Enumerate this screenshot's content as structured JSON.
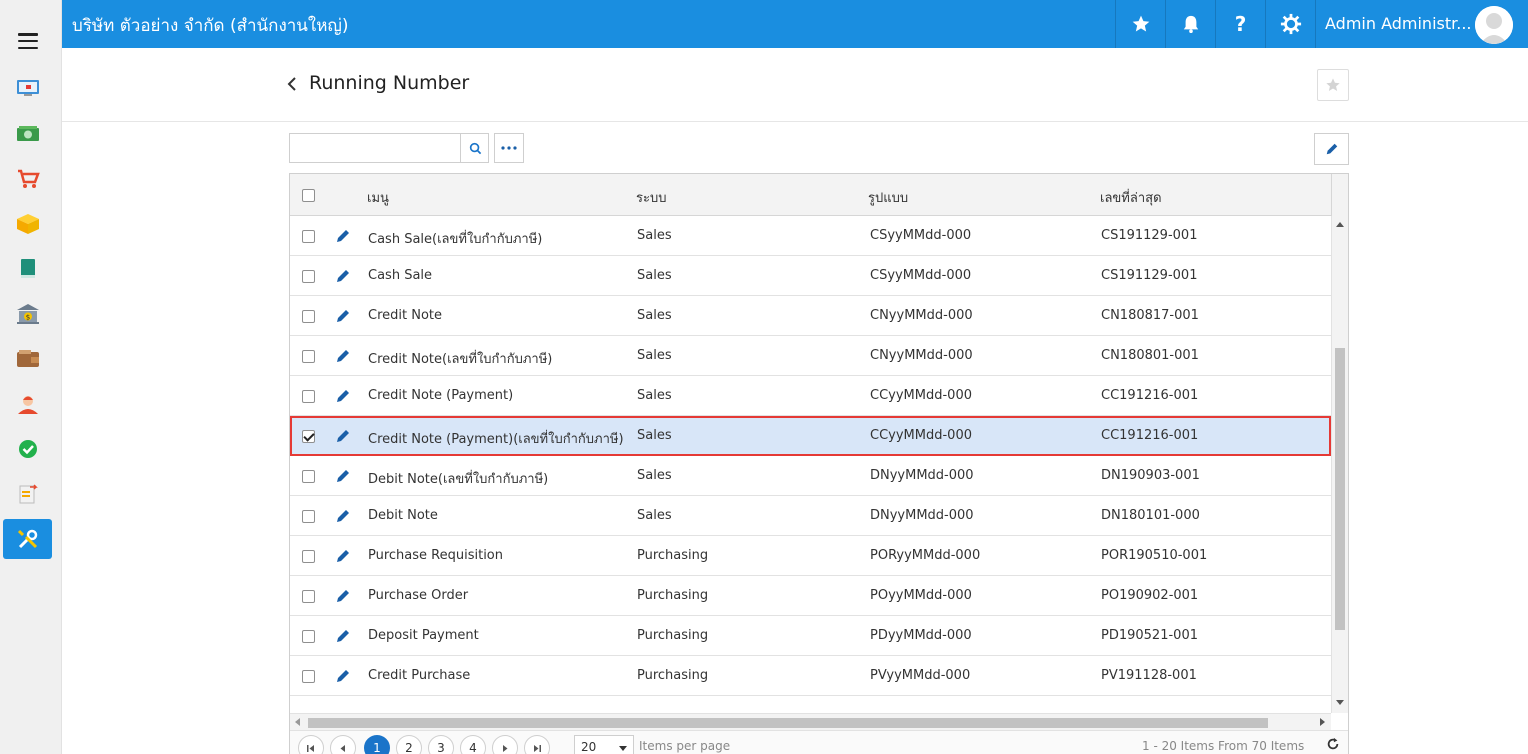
{
  "topbar": {
    "company": "บริษัท ตัวอย่าง จำกัด (สำนักงานใหญ่)",
    "user_name": "Admin Administr...",
    "icons": [
      "star-icon",
      "bell-icon",
      "help-icon",
      "gear-icon"
    ]
  },
  "sidebar": {
    "items": [
      "dashboard-icon",
      "money-icon",
      "cart-icon",
      "box-icon",
      "book-icon",
      "bank-icon",
      "wallet-icon",
      "employee-icon",
      "approve-icon",
      "transfer-icon",
      "settings-tools-icon"
    ],
    "active": "settings-tools-icon"
  },
  "header": {
    "title": "Running Number"
  },
  "toolbar": {
    "search_value": "",
    "search_placeholder": ""
  },
  "grid": {
    "columns": [
      "เมนู",
      "ระบบ",
      "รูปแบบ",
      "เลขที่ล่าสุด"
    ],
    "rows": [
      {
        "menu": "Cash Sale(เลขที่ใบกำกับภาษี)",
        "system": "Sales",
        "format": "CSyyMMdd-000",
        "latest": "CS191129-001",
        "checked": false
      },
      {
        "menu": "Cash Sale",
        "system": "Sales",
        "format": "CSyyMMdd-000",
        "latest": "CS191129-001",
        "checked": false
      },
      {
        "menu": "Credit Note",
        "system": "Sales",
        "format": "CNyyMMdd-000",
        "latest": "CN180817-001",
        "checked": false
      },
      {
        "menu": "Credit Note(เลขที่ใบกำกับภาษี)",
        "system": "Sales",
        "format": "CNyyMMdd-000",
        "latest": "CN180801-001",
        "checked": false
      },
      {
        "menu": "Credit Note (Payment)",
        "system": "Sales",
        "format": "CCyyMMdd-000",
        "latest": "CC191216-001",
        "checked": false
      },
      {
        "menu": "Credit Note (Payment)(เลขที่ใบกำกับภาษี)",
        "system": "Sales",
        "format": "CCyyMMdd-000",
        "latest": "CC191216-001",
        "checked": true
      },
      {
        "menu": "Debit Note(เลขที่ใบกำกับภาษี)",
        "system": "Sales",
        "format": "DNyyMMdd-000",
        "latest": "DN190903-001",
        "checked": false
      },
      {
        "menu": "Debit Note",
        "system": "Sales",
        "format": "DNyyMMdd-000",
        "latest": "DN180101-000",
        "checked": false
      },
      {
        "menu": "Purchase Requisition",
        "system": "Purchasing",
        "format": "PORyyMMdd-000",
        "latest": "POR190510-001",
        "checked": false
      },
      {
        "menu": "Purchase Order",
        "system": "Purchasing",
        "format": "POyyMMdd-000",
        "latest": "PO190902-001",
        "checked": false
      },
      {
        "menu": "Deposit Payment",
        "system": "Purchasing",
        "format": "PDyyMMdd-000",
        "latest": "PD190521-001",
        "checked": false
      },
      {
        "menu": "Credit Purchase",
        "system": "Purchasing",
        "format": "PVyyMMdd-000",
        "latest": "PV191128-001",
        "checked": false
      }
    ]
  },
  "pager": {
    "pages": [
      "1",
      "2",
      "3",
      "4"
    ],
    "current_page": "1",
    "page_size": "20",
    "items_per_page_label": "Items per page",
    "info": "1 - 20 Items From 70 Items"
  },
  "colors": {
    "brand": "#1a8ee0",
    "selected_row": "#d8e6f8",
    "selected_border": "#e53935",
    "edit_icon": "#1a5fa8"
  }
}
